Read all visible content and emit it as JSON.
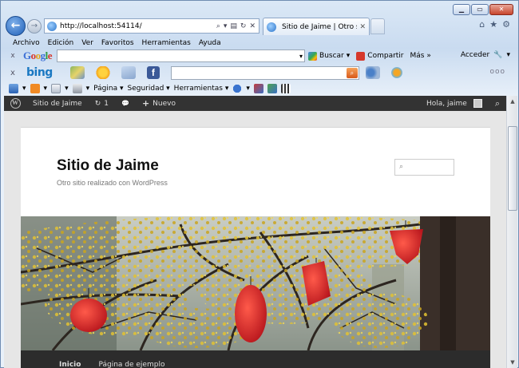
{
  "browser": {
    "url": "http://localhost:54114/",
    "tab_title": "Sitio de Jaime | Otro sitio re...",
    "caption": {
      "minimize": "▁",
      "maximize": "▭",
      "close": "✕"
    },
    "nav": {
      "back": "←",
      "forward": "→"
    },
    "address_tools": {
      "search": "⌕",
      "dropdown": "▾",
      "compat": "▤",
      "refresh": "↻",
      "stop": "✕"
    },
    "tab_close": "✕",
    "right_icons": {
      "home": "⌂",
      "favorites": "★",
      "tools": "⚙"
    }
  },
  "menubar": [
    "Archivo",
    "Edición",
    "Ver",
    "Favoritos",
    "Herramientas",
    "Ayuda"
  ],
  "google_toolbar": {
    "close": "x",
    "logo": "Google",
    "search_dropdown": "▾",
    "buscar": "Buscar",
    "buscar_dropdown": "▾",
    "compartir": "Compartir",
    "mas": "Más »",
    "acceder": "Acceder",
    "wrench": "🔧",
    "acceder_dropdown": "▾"
  },
  "bing_toolbar": {
    "close": "x",
    "logo": "bing",
    "go": "⌕",
    "more": "ooo"
  },
  "command_bar": {
    "home_dropdown": "▾",
    "feeds_dropdown": "▾",
    "mail_dropdown": "▾",
    "print_dropdown": "▾",
    "pagina": "Página ▾",
    "seguridad": "Seguridad ▾",
    "herramientas": "Herramientas ▾",
    "help_dropdown": "▾"
  },
  "wp_adminbar": {
    "logo": "W",
    "site_name": "Sitio de Jaime",
    "updates_icon": "↻",
    "updates_count": "1",
    "comments_icon": "💬",
    "new_icon": "+",
    "new_label": "Nuevo",
    "greeting": "Hola, jaime",
    "search_icon": "⌕"
  },
  "site": {
    "title": "Sitio de Jaime",
    "description": "Otro sitio realizado con WordPress",
    "search_icon": "⌕",
    "nav": [
      "Inicio",
      "Página de ejemplo"
    ]
  },
  "scrollbar": {
    "up": "▲",
    "down": "▼"
  },
  "colors": {
    "wp_adminbar": "#333333",
    "lantern_red": "#e8262a",
    "blossom_yellow": "#e0c030",
    "ie_blue": "#1e5fb8"
  }
}
